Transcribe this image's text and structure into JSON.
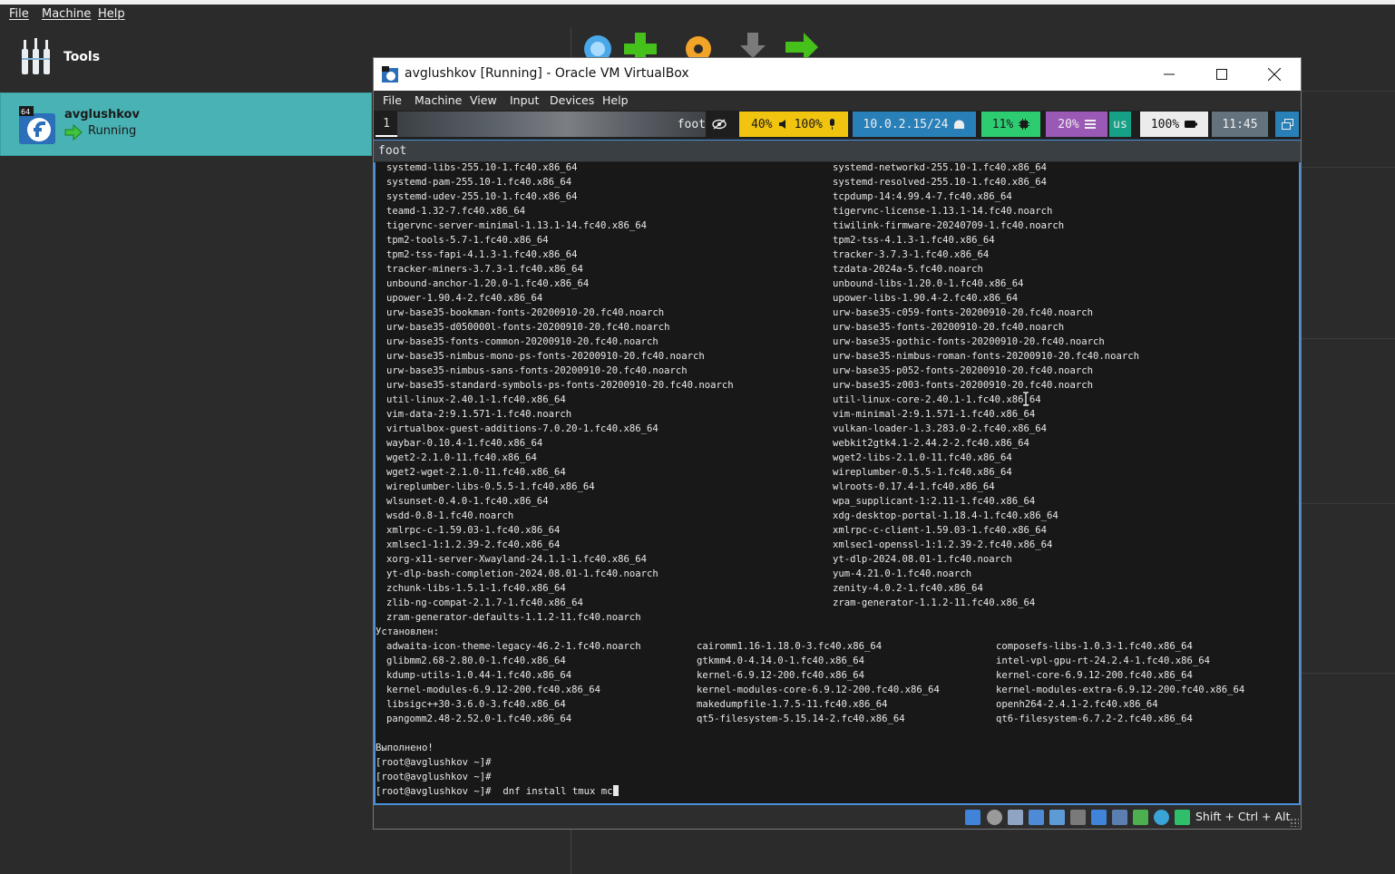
{
  "host": {
    "menu": [
      "File",
      "Machine",
      "Help"
    ],
    "tools_label": "Tools",
    "vm_name": "avglushkov",
    "vm_state": "Running",
    "vm_badge": "64"
  },
  "window": {
    "title": "avglushkov [Running] - Oracle VM VirtualBox",
    "menu": [
      "File",
      "Machine",
      "View",
      "Input",
      "Devices",
      "Help"
    ]
  },
  "waybar": {
    "workspace": "1",
    "window_title": "foot",
    "volume": "40%",
    "mic": "100%",
    "network": "10.0.2.15/24",
    "cpu": "11%",
    "memory": "20%",
    "layout": "us",
    "battery": "100%",
    "clock": "11:45"
  },
  "terminal": {
    "title": "foot",
    "upgraded_left": [
      "systemd-libs-255.10-1.fc40.x86_64",
      "systemd-pam-255.10-1.fc40.x86_64",
      "systemd-udev-255.10-1.fc40.x86_64",
      "teamd-1.32-7.fc40.x86_64",
      "tigervnc-server-minimal-1.13.1-14.fc40.x86_64",
      "tpm2-tools-5.7-1.fc40.x86_64",
      "tpm2-tss-fapi-4.1.3-1.fc40.x86_64",
      "tracker-miners-3.7.3-1.fc40.x86_64",
      "unbound-anchor-1.20.0-1.fc40.x86_64",
      "upower-1.90.4-2.fc40.x86_64",
      "urw-base35-bookman-fonts-20200910-20.fc40.noarch",
      "urw-base35-d050000l-fonts-20200910-20.fc40.noarch",
      "urw-base35-fonts-common-20200910-20.fc40.noarch",
      "urw-base35-nimbus-mono-ps-fonts-20200910-20.fc40.noarch",
      "urw-base35-nimbus-sans-fonts-20200910-20.fc40.noarch",
      "urw-base35-standard-symbols-ps-fonts-20200910-20.fc40.noarch",
      "util-linux-2.40.1-1.fc40.x86_64",
      "vim-data-2:9.1.571-1.fc40.noarch",
      "virtualbox-guest-additions-7.0.20-1.fc40.x86_64",
      "waybar-0.10.4-1.fc40.x86_64",
      "wget2-2.1.0-11.fc40.x86_64",
      "wget2-wget-2.1.0-11.fc40.x86_64",
      "wireplumber-libs-0.5.5-1.fc40.x86_64",
      "wlsunset-0.4.0-1.fc40.x86_64",
      "wsdd-0.8-1.fc40.noarch",
      "xmlrpc-c-1.59.03-1.fc40.x86_64",
      "xmlsec1-1:1.2.39-2.fc40.x86_64",
      "xorg-x11-server-Xwayland-24.1.1-1.fc40.x86_64",
      "yt-dlp-bash-completion-2024.08.01-1.fc40.noarch",
      "zchunk-libs-1.5.1-1.fc40.x86_64",
      "zlib-ng-compat-2.1.7-1.fc40.x86_64",
      "zram-generator-defaults-1.1.2-11.fc40.noarch"
    ],
    "upgraded_right": [
      "systemd-networkd-255.10-1.fc40.x86_64",
      "systemd-resolved-255.10-1.fc40.x86_64",
      "tcpdump-14:4.99.4-7.fc40.x86_64",
      "tigervnc-license-1.13.1-14.fc40.noarch",
      "tiwilink-firmware-20240709-1.fc40.noarch",
      "tpm2-tss-4.1.3-1.fc40.x86_64",
      "tracker-3.7.3-1.fc40.x86_64",
      "tzdata-2024a-5.fc40.noarch",
      "unbound-libs-1.20.0-1.fc40.x86_64",
      "upower-libs-1.90.4-2.fc40.x86_64",
      "urw-base35-c059-fonts-20200910-20.fc40.noarch",
      "urw-base35-fonts-20200910-20.fc40.noarch",
      "urw-base35-gothic-fonts-20200910-20.fc40.noarch",
      "urw-base35-nimbus-roman-fonts-20200910-20.fc40.noarch",
      "urw-base35-p052-fonts-20200910-20.fc40.noarch",
      "urw-base35-z003-fonts-20200910-20.fc40.noarch",
      "util-linux-core-2.40.1-1.fc40.x86_64",
      "vim-minimal-2:9.1.571-1.fc40.x86_64",
      "vulkan-loader-1.3.283.0-2.fc40.x86_64",
      "webkit2gtk4.1-2.44.2-2.fc40.x86_64",
      "wget2-libs-2.1.0-11.fc40.x86_64",
      "wireplumber-0.5.5-1.fc40.x86_64",
      "wlroots-0.17.4-1.fc40.x86_64",
      "wpa_supplicant-1:2.11-1.fc40.x86_64",
      "xdg-desktop-portal-1.18.4-1.fc40.x86_64",
      "xmlrpc-c-client-1.59.03-1.fc40.x86_64",
      "xmlsec1-openssl-1:1.2.39-2.fc40.x86_64",
      "yt-dlp-2024.08.01-1.fc40.noarch",
      "yum-4.21.0-1.fc40.noarch",
      "zenity-4.0.2-1.fc40.x86_64",
      "zram-generator-1.1.2-11.fc40.x86_64"
    ],
    "installed_header": "Установлен:",
    "installed_col1": [
      "adwaita-icon-theme-legacy-46.2-1.fc40.noarch",
      "glibmm2.68-2.80.0-1.fc40.x86_64",
      "kdump-utils-1.0.44-1.fc40.x86_64",
      "kernel-modules-6.9.12-200.fc40.x86_64",
      "libsigc++30-3.6.0-3.fc40.x86_64",
      "pangomm2.48-2.52.0-1.fc40.x86_64"
    ],
    "installed_col2": [
      "cairomm1.16-1.18.0-3.fc40.x86_64",
      "gtkmm4.0-4.14.0-1.fc40.x86_64",
      "kernel-6.9.12-200.fc40.x86_64",
      "kernel-modules-core-6.9.12-200.fc40.x86_64",
      "makedumpfile-1.7.5-11.fc40.x86_64",
      "qt5-filesystem-5.15.14-2.fc40.x86_64"
    ],
    "installed_col3": [
      "composefs-libs-1.0.3-1.fc40.x86_64",
      "intel-vpl-gpu-rt-24.2.4-1.fc40.x86_64",
      "kernel-core-6.9.12-200.fc40.x86_64",
      "kernel-modules-extra-6.9.12-200.fc40.x86_64",
      "openh264-2.4.1-2.fc40.x86_64",
      "qt6-filesystem-6.7.2-2.fc40.x86_64"
    ],
    "done": "Выполнено!",
    "prompt": "[root@avglushkov ~]#",
    "command": "dnf install tmux mc"
  },
  "status": {
    "host_key": "Shift + Ctrl + Alt"
  }
}
